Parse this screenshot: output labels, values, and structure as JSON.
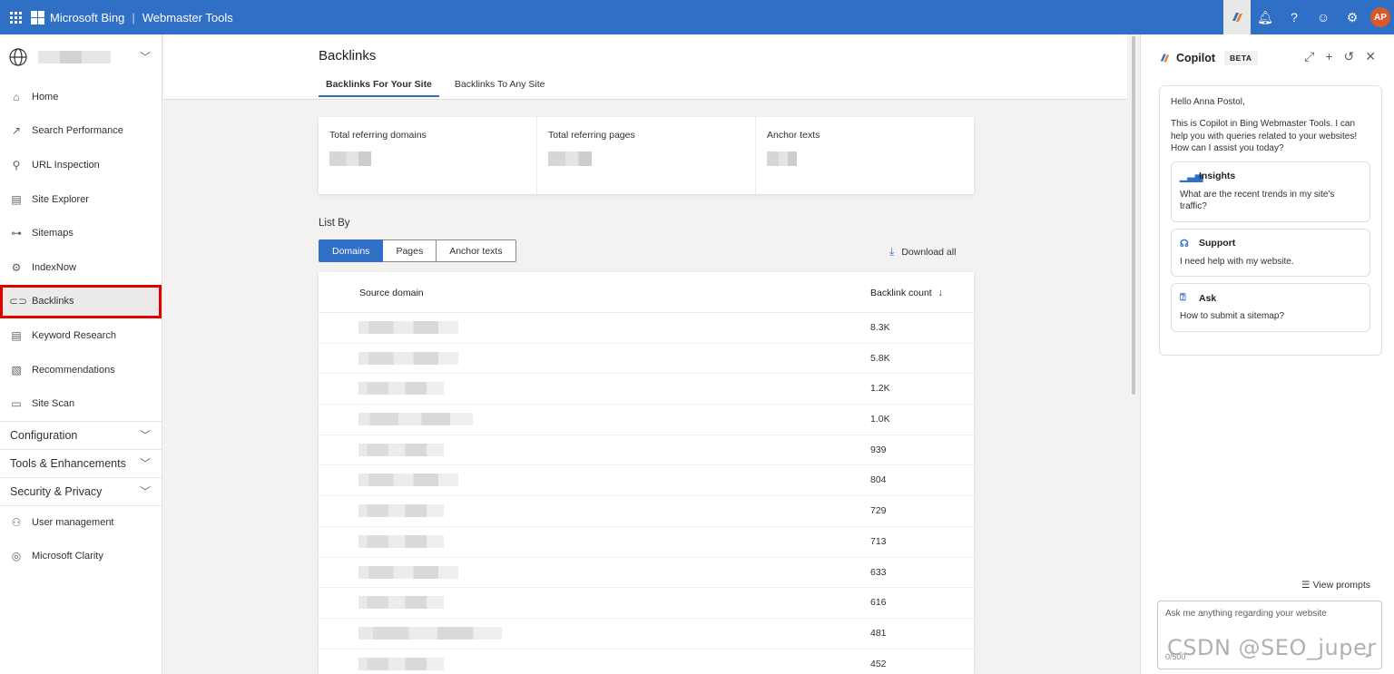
{
  "app": {
    "brand": "Microsoft Bing",
    "product": "Webmaster Tools",
    "avatar_initials": "AP",
    "accent": "#2f6fc5"
  },
  "topbar_icons": [
    "copilot-icon",
    "bell-icon",
    "help-icon",
    "feedback-icon",
    "gear-icon"
  ],
  "sidebar": {
    "items": [
      {
        "label": "Home",
        "icon": "home-icon",
        "glyph": "⌂"
      },
      {
        "label": "Search Performance",
        "icon": "trend-icon",
        "glyph": "↗"
      },
      {
        "label": "URL Inspection",
        "icon": "search-icon",
        "glyph": "⚲"
      },
      {
        "label": "Site Explorer",
        "icon": "document-icon",
        "glyph": "▤"
      },
      {
        "label": "Sitemaps",
        "icon": "sitemap-icon",
        "glyph": "⊶"
      },
      {
        "label": "IndexNow",
        "icon": "indexnow-icon",
        "glyph": "⚙"
      },
      {
        "label": "Backlinks",
        "icon": "link-icon",
        "glyph": "⊂⊃",
        "active": true
      },
      {
        "label": "Keyword Research",
        "icon": "list-icon",
        "glyph": "▤"
      },
      {
        "label": "Recommendations",
        "icon": "checklist-icon",
        "glyph": "▧"
      },
      {
        "label": "Site Scan",
        "icon": "scan-icon",
        "glyph": "▭"
      }
    ],
    "groups": [
      {
        "label": "Configuration"
      },
      {
        "label": "Tools & Enhancements"
      },
      {
        "label": "Security & Privacy"
      }
    ],
    "bottom_items": [
      {
        "label": "User management",
        "icon": "user-icon",
        "glyph": "⚇"
      },
      {
        "label": "Microsoft Clarity",
        "icon": "clarity-icon",
        "glyph": "◎"
      }
    ]
  },
  "main": {
    "title": "Backlinks",
    "tabs": [
      {
        "label": "Backlinks For Your Site",
        "active": true
      },
      {
        "label": "Backlinks To Any Site",
        "active": false
      }
    ],
    "stats": [
      {
        "label": "Total referring domains"
      },
      {
        "label": "Total referring pages"
      },
      {
        "label": "Anchor texts"
      }
    ],
    "list_by": {
      "label": "List By",
      "options": [
        {
          "label": "Domains",
          "active": true
        },
        {
          "label": "Pages",
          "active": false
        },
        {
          "label": "Anchor texts",
          "active": false
        }
      ]
    },
    "download_label": "Download all",
    "table": {
      "columns": [
        "Source domain",
        "Backlink count"
      ],
      "sort_indicator": "↓",
      "rows": [
        {
          "count": "8.3K"
        },
        {
          "count": "5.8K"
        },
        {
          "count": "1.2K"
        },
        {
          "count": "1.0K"
        },
        {
          "count": "939"
        },
        {
          "count": "804"
        },
        {
          "count": "729"
        },
        {
          "count": "713"
        },
        {
          "count": "633"
        },
        {
          "count": "616"
        },
        {
          "count": "481"
        },
        {
          "count": "452"
        }
      ]
    }
  },
  "copilot": {
    "title": "Copilot",
    "badge": "BETA",
    "greeting": "Hello Anna Postol,",
    "intro": "This is Copilot in Bing Webmaster Tools. I can help you with queries related to your websites! How can I assist you today?",
    "suggestions": [
      {
        "title": "Insights",
        "text": "What are the recent trends in my site's traffic?",
        "icon": "chart-icon"
      },
      {
        "title": "Support",
        "text": "I need help with my website.",
        "icon": "headset-icon"
      },
      {
        "title": "Ask",
        "text": "How to submit a sitemap?",
        "icon": "question-icon"
      }
    ],
    "view_prompts": "View prompts",
    "input_placeholder": "Ask me anything regarding your website",
    "counter": "0/500"
  },
  "watermark": "CSDN @SEO_juper"
}
